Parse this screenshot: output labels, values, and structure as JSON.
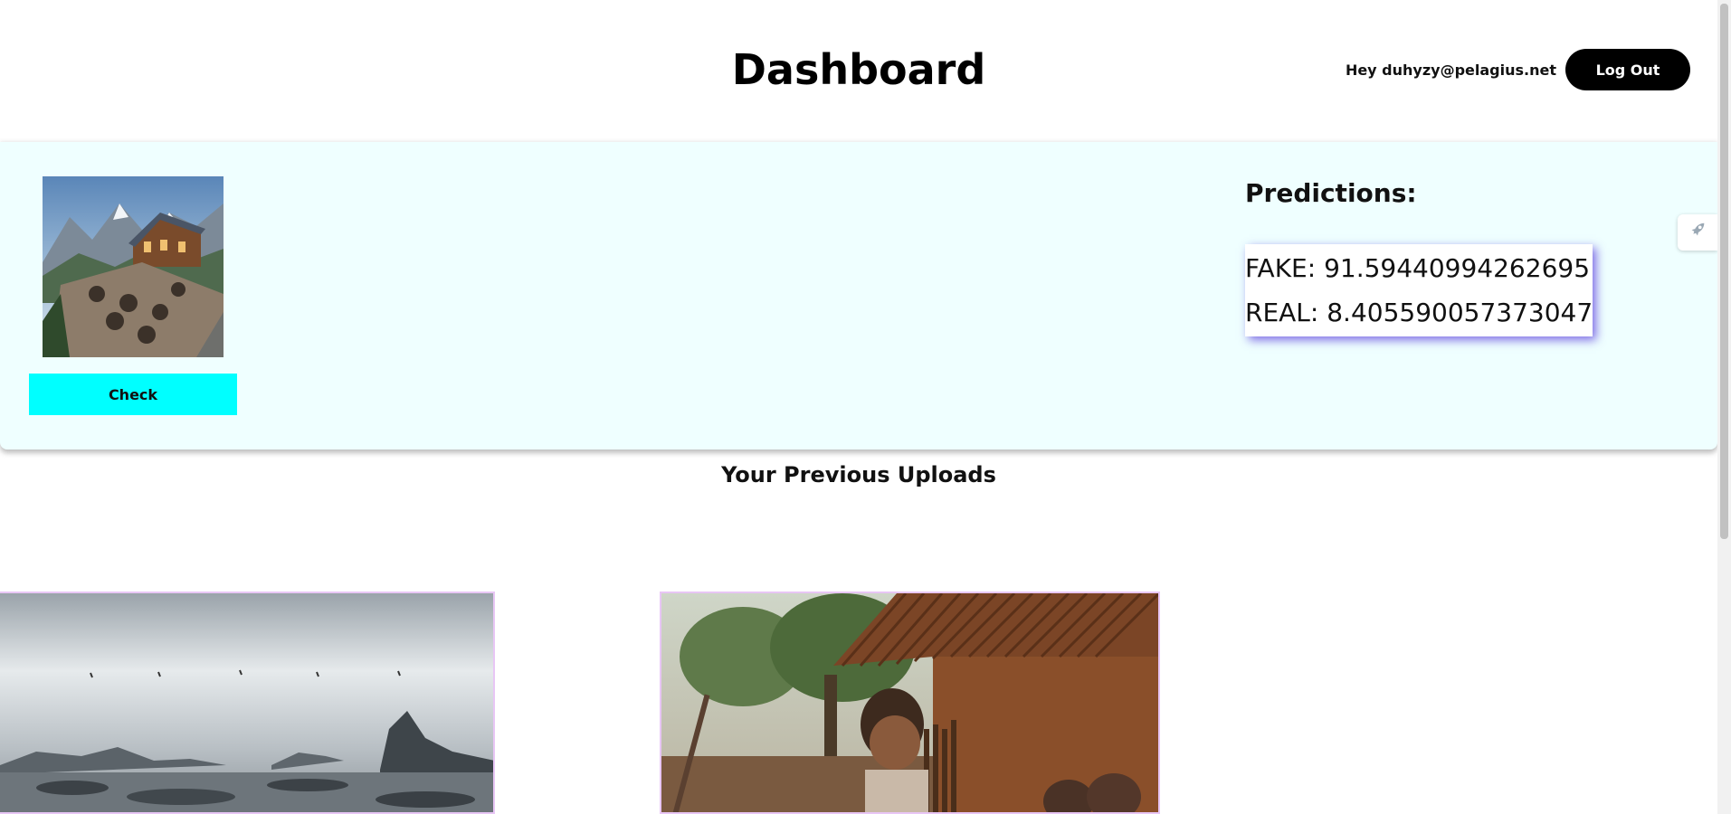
{
  "header": {
    "title": "Dashboard",
    "greeting": "Hey duhyzy@pelagius.net",
    "logout_label": "Log Out"
  },
  "upload": {
    "check_label": "Check"
  },
  "predictions": {
    "title": "Predictions:",
    "fake": "FAKE: 91.59440994262695",
    "real": "REAL: 8.405590057373047"
  },
  "uploads": {
    "heading": "Your Previous Uploads"
  },
  "colors": {
    "panel_bg": "#efffff",
    "check_button": "#00ffff",
    "logout_button": "#000000",
    "prediction_shadow": "#5a3cdc"
  }
}
